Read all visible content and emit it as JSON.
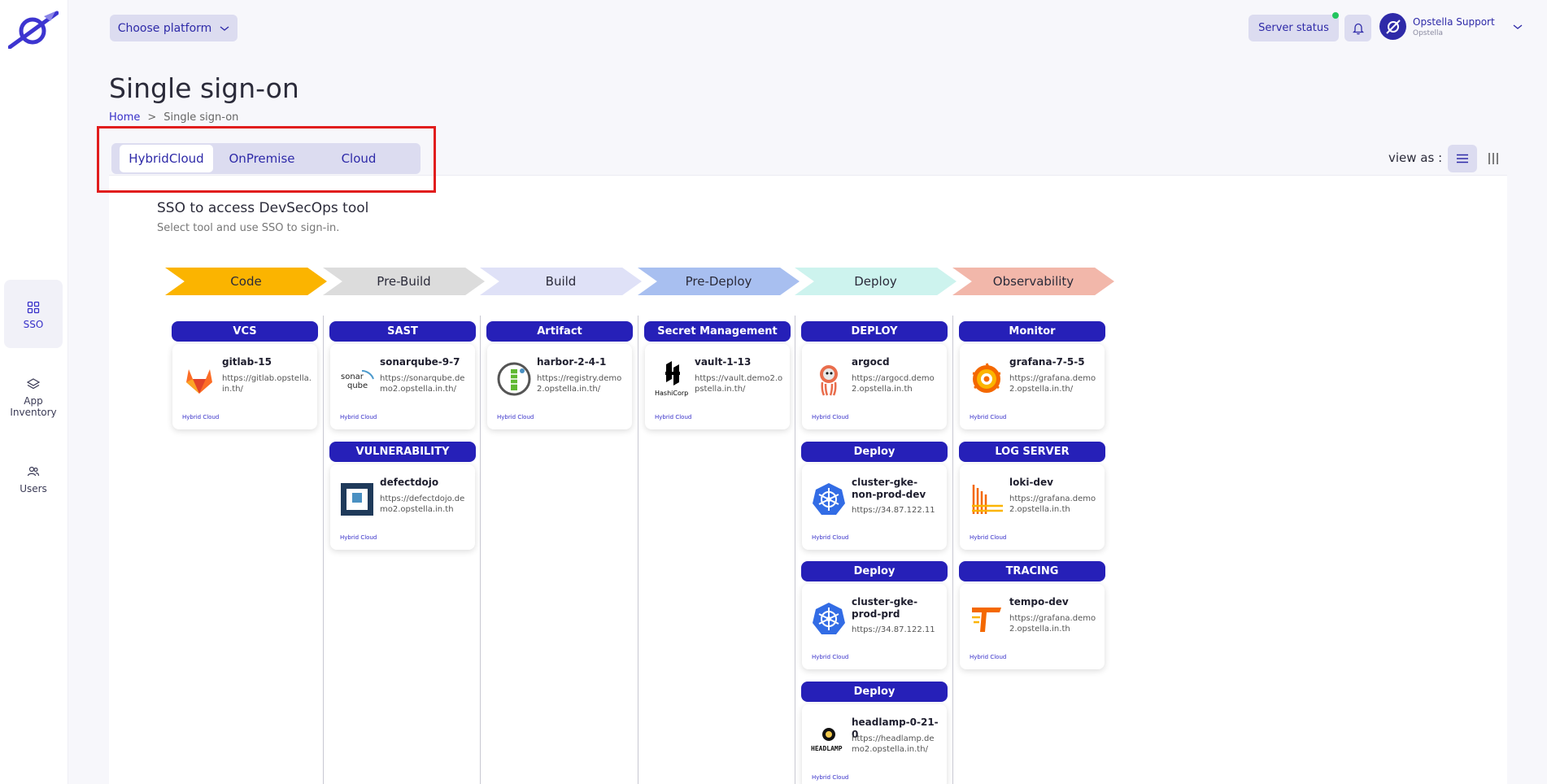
{
  "sidebar": {
    "items": [
      {
        "label": "SSO",
        "icon": "grid-icon"
      },
      {
        "label": "App Inventory",
        "icon": "layers-icon"
      },
      {
        "label": "Users",
        "icon": "users-icon"
      }
    ]
  },
  "topbar": {
    "platform_label": "Choose platform",
    "server_status_label": "Server status",
    "user_name": "Opstella Support",
    "user_org": "Opstella"
  },
  "header": {
    "title": "Single sign-on",
    "breadcrumb": {
      "home": "Home",
      "separator": ">",
      "current": "Single sign-on"
    }
  },
  "tabs": [
    "HybridCloud",
    "OnPremise",
    "Cloud"
  ],
  "view_as": "view as :",
  "panel": {
    "title": "SSO to access DevSecOps tool",
    "subtitle": "Select tool and use SSO to sign-in."
  },
  "stages": [
    {
      "label": "Code",
      "color": "#fbb400"
    },
    {
      "label": "Pre-Build",
      "color": "#dcdcdc"
    },
    {
      "label": "Build",
      "color": "#dfe1f7"
    },
    {
      "label": "Pre-Deploy",
      "color": "#a8bff0"
    },
    {
      "label": "Deploy",
      "color": "#cdf3ee"
    },
    {
      "label": "Observability",
      "color": "#f2b7aa"
    }
  ],
  "columns": [
    {
      "groups": [
        {
          "category": "VCS",
          "tool": {
            "name": "gitlab-15",
            "url": "https://gitlab.opstella.in.th/",
            "env": "Hybrid Cloud",
            "icon": "gitlab-icon"
          }
        }
      ]
    },
    {
      "groups": [
        {
          "category": "SAST",
          "tool": {
            "name": "sonarqube-9-7",
            "url": "https://sonarqube.demo2.opstella.in.th/",
            "env": "Hybrid Cloud",
            "icon": "sonarqube-icon"
          }
        },
        {
          "category": "VULNERABILITY",
          "tool": {
            "name": "defectdojo",
            "url": "https://defectdojo.demo2.opstella.in.th",
            "env": "Hybrid Cloud",
            "icon": "defectdojo-icon"
          }
        }
      ]
    },
    {
      "groups": [
        {
          "category": "Artifact",
          "tool": {
            "name": "harbor-2-4-1",
            "url": "https://registry.demo2.opstella.in.th/",
            "env": "Hybrid Cloud",
            "icon": "harbor-icon"
          }
        }
      ]
    },
    {
      "groups": [
        {
          "category": "Secret Management",
          "tool": {
            "name": "vault-1-13",
            "url": "https://vault.demo2.opstella.in.th/",
            "env": "Hybrid Cloud",
            "icon": "hashicorp-icon"
          }
        }
      ]
    },
    {
      "groups": [
        {
          "category": "DEPLOY",
          "tool": {
            "name": "argocd",
            "url": "https://argocd.demo2.opstella.in.th",
            "env": "Hybrid Cloud",
            "icon": "argocd-icon"
          }
        },
        {
          "category": "Deploy",
          "tool": {
            "name": "cluster-gke-non-prod-dev",
            "url": "https://34.87.122.11",
            "env": "Hybrid Cloud",
            "icon": "kubernetes-icon"
          }
        },
        {
          "category": "Deploy",
          "tool": {
            "name": "cluster-gke-prod-prd",
            "url": "https://34.87.122.11",
            "env": "Hybrid Cloud",
            "icon": "kubernetes-icon"
          }
        },
        {
          "category": "Deploy",
          "tool": {
            "name": "headlamp-0-21-0",
            "url": "https://headlamp.demo2.opstella.in.th/",
            "env": "Hybrid Cloud",
            "icon": "headlamp-icon"
          }
        }
      ]
    },
    {
      "groups": [
        {
          "category": "Monitor",
          "tool": {
            "name": "grafana-7-5-5",
            "url": "https://grafana.demo2.opstella.in.th/",
            "env": "Hybrid Cloud",
            "icon": "grafana-icon"
          }
        },
        {
          "category": "LOG SERVER",
          "tool": {
            "name": "loki-dev",
            "url": "https://grafana.demo2.opstella.in.th",
            "env": "Hybrid Cloud",
            "icon": "loki-icon"
          }
        },
        {
          "category": "TRACING",
          "tool": {
            "name": "tempo-dev",
            "url": "https://grafana.demo2.opstella.in.th",
            "env": "Hybrid Cloud",
            "icon": "tempo-icon"
          }
        }
      ]
    }
  ],
  "colors": {
    "primary": "#2620b8",
    "accent_bg": "#dcdcf0",
    "highlight": "#e11d1d"
  }
}
